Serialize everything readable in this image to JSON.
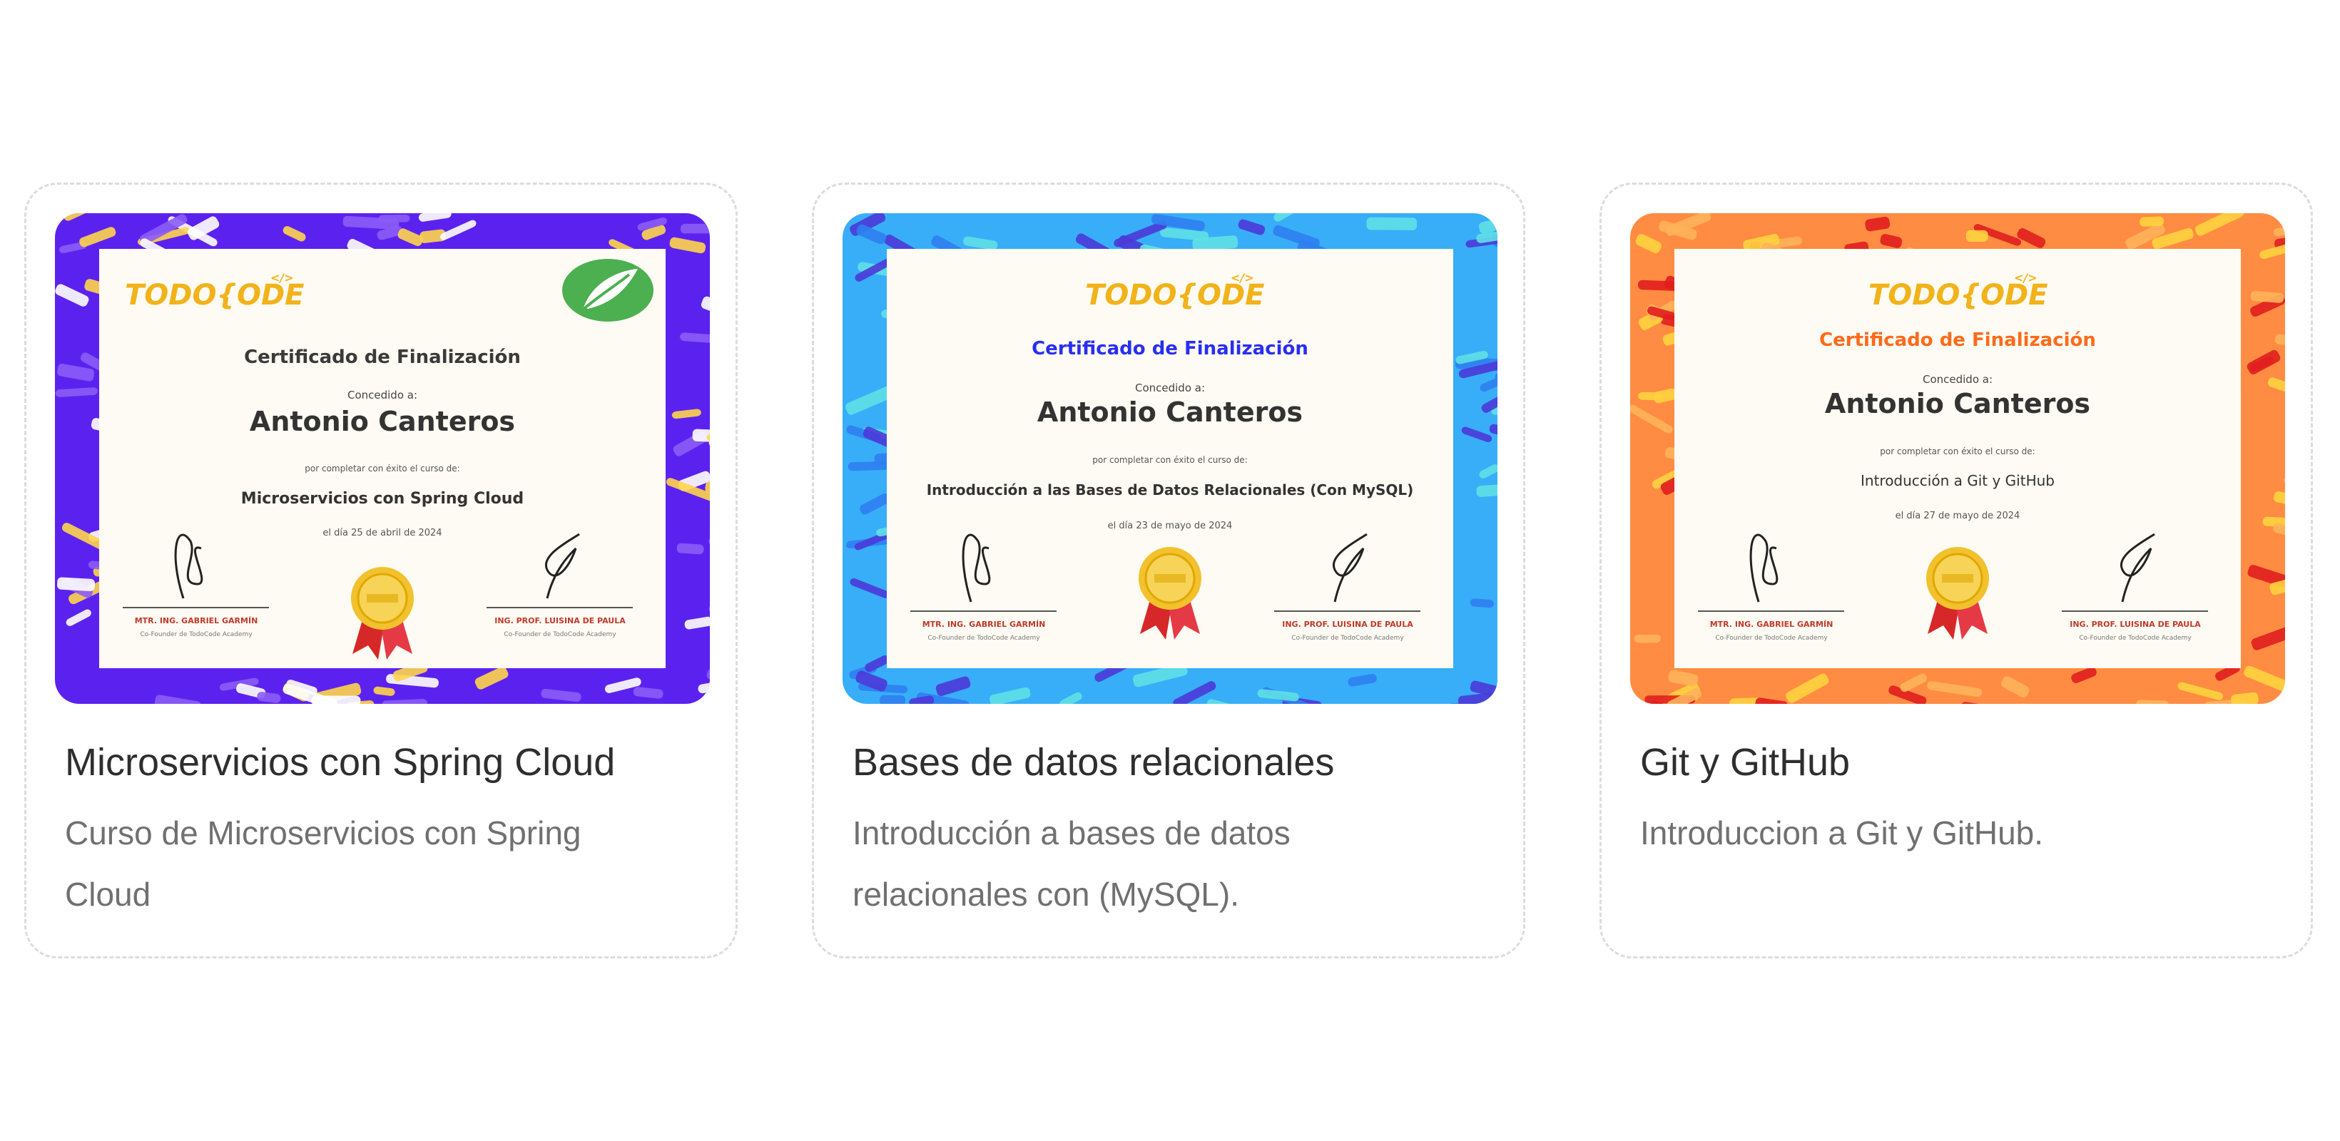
{
  "courses": [
    {
      "title": "Microservicios con Spring Cloud",
      "description": "Curso de Microservicios con Spring Cloud",
      "colors": {
        "frame": "#5b22ef",
        "stroke_a": "#8b5cf6",
        "stroke_b": "#ffffff",
        "stroke_c": "#ffd54a",
        "heading": "#3a3a3a"
      },
      "certificate": {
        "logo_text": "TODO{ODE",
        "logo_tag": "</>",
        "heading": "Certificado de Finalización",
        "awarded_to_label": "Concedido a:",
        "recipient": "Antonio Canteros",
        "completion_text": "por completar con éxito el curso de:",
        "course_line": "Microservicios con Spring Cloud",
        "date_line": "el día 25 de abril de 2024",
        "signer_left_name": "MTR. ING. GABRIEL GARMÍN",
        "signer_left_role": "Co-Founder de TodoCode Academy",
        "signer_right_name": "ING. PROF. LUISINA DE PAULA",
        "signer_right_role": "Co-Founder de TodoCode Academy"
      }
    },
    {
      "title": "Bases de datos relacionales",
      "description": "Introducción a bases de datos relacionales con (MySQL).",
      "colors": {
        "frame": "#38aef8",
        "stroke_a": "#4b3ad8",
        "stroke_b": "#5fe0e6",
        "stroke_c": "#2f7ff0",
        "heading": "#2a2ef0"
      },
      "certificate": {
        "logo_text": "TODO{ODE",
        "logo_tag": "</>",
        "heading": "Certificado de Finalización",
        "awarded_to_label": "Concedido a:",
        "recipient": "Antonio Canteros",
        "completion_text": "por completar con éxito el curso de:",
        "course_line": "Introducción a las Bases de Datos Relacionales (Con MySQL)",
        "date_line": "el día 23 de mayo de 2024",
        "signer_left_name": "MTR. ING. GABRIEL GARMÍN",
        "signer_left_role": "Co-Founder de TodoCode Academy",
        "signer_right_name": "ING. PROF. LUISINA DE PAULA",
        "signer_right_role": "Co-Founder de TodoCode Academy"
      }
    },
    {
      "title": "Git y GitHub",
      "description": "Introduccion a Git y GitHub.",
      "colors": {
        "frame": "#ff8c42",
        "stroke_a": "#e01e1e",
        "stroke_b": "#ffd23f",
        "stroke_c": "#ffb25a",
        "heading": "#ff6a1a"
      },
      "certificate": {
        "logo_text": "TODO{ODE",
        "logo_tag": "</>",
        "heading": "Certificado de Finalización",
        "awarded_to_label": "Concedido a:",
        "recipient": "Antonio Canteros",
        "completion_text": "por completar con éxito el curso de:",
        "course_line": "Introducción a Git y GitHub",
        "date_line": "el día 27 de mayo de 2024",
        "signer_left_name": "MTR. ING. GABRIEL GARMÍN",
        "signer_left_role": "Co-Founder de TodoCode Academy",
        "signer_right_name": "ING. PROF. LUISINA DE PAULA",
        "signer_right_role": "Co-Founder de TodoCode Academy"
      }
    }
  ],
  "icons": {
    "spring_logo": "spring-leaf-icon",
    "medal": "gold-medal-icon"
  }
}
